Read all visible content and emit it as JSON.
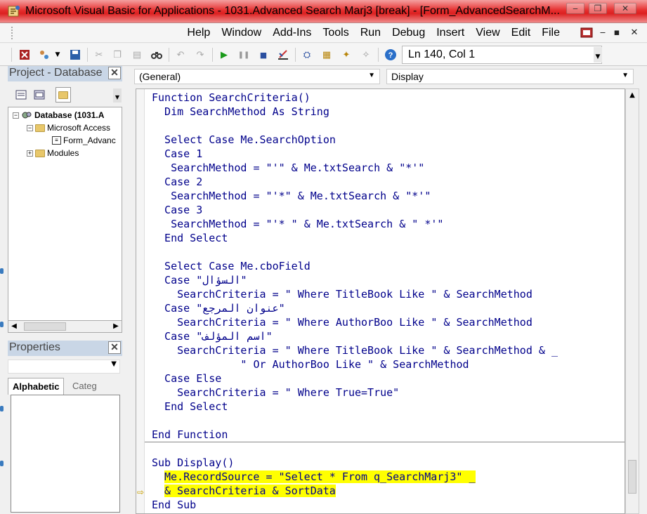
{
  "window": {
    "title": "Microsoft Visual Basic for Applications - 1031.Advanced Search Marj3 [break] - [Form_AdvancedSearchM...",
    "minimize": "‒",
    "restore": "❐",
    "close": "✕"
  },
  "menubar": {
    "items": [
      "Help",
      "Window",
      "Add-Ins",
      "Tools",
      "Run",
      "Debug",
      "Insert",
      "View",
      "Edit",
      "File"
    ],
    "mdi_min": "‒",
    "mdi_restore": "▪",
    "mdi_close": "✕"
  },
  "toolbar": {
    "position_text": "Ln 140, Col 1"
  },
  "project_pane": {
    "title": "Project - Database",
    "close": "✕",
    "tree": {
      "root": "Database (1031.A",
      "group": "Microsoft Access",
      "form": "Form_Advanc",
      "modules": "Modules"
    }
  },
  "properties_pane": {
    "title": "Properties",
    "close": "✕",
    "tabs": [
      "Alphabetic",
      "Categ"
    ]
  },
  "code_window": {
    "object_combo": "(General)",
    "procedure_combo": "Display",
    "lines": [
      "Function SearchCriteria()",
      "  Dim SearchMethod As String",
      "",
      "  Select Case Me.SearchOption",
      "  Case 1",
      "   SearchMethod = \"'\" & Me.txtSearch & \"*'\"",
      "  Case 2",
      "   SearchMethod = \"'*\" & Me.txtSearch & \"*'\"",
      "  Case 3",
      "   SearchMethod = \"'* \" & Me.txtSearch & \" *'\"",
      "  End Select",
      "",
      "  Select Case Me.cboField",
      "  Case \"السؤال\"",
      "    SearchCriteria = \" Where TitleBook Like \" & SearchMethod",
      "  Case \"عنوان المرجع\"",
      "    SearchCriteria = \" Where AuthorBoo Like \" & SearchMethod",
      "  Case \"اسم المؤلف\"",
      "    SearchCriteria = \" Where TitleBook Like \" & SearchMethod & _",
      "              \" Or AuthorBoo Like \" & SearchMethod",
      "  Case Else",
      "    SearchCriteria = \" Where True=True\"",
      "  End Select",
      "",
      "End Function"
    ],
    "sub_lines": [
      "Sub Display()",
      "  Me.RecordSource = \"Select * From q_SearchMarj3\" _",
      "  & SearchCriteria & SortData",
      "End Sub"
    ],
    "current_statement_marker": "⇨"
  }
}
